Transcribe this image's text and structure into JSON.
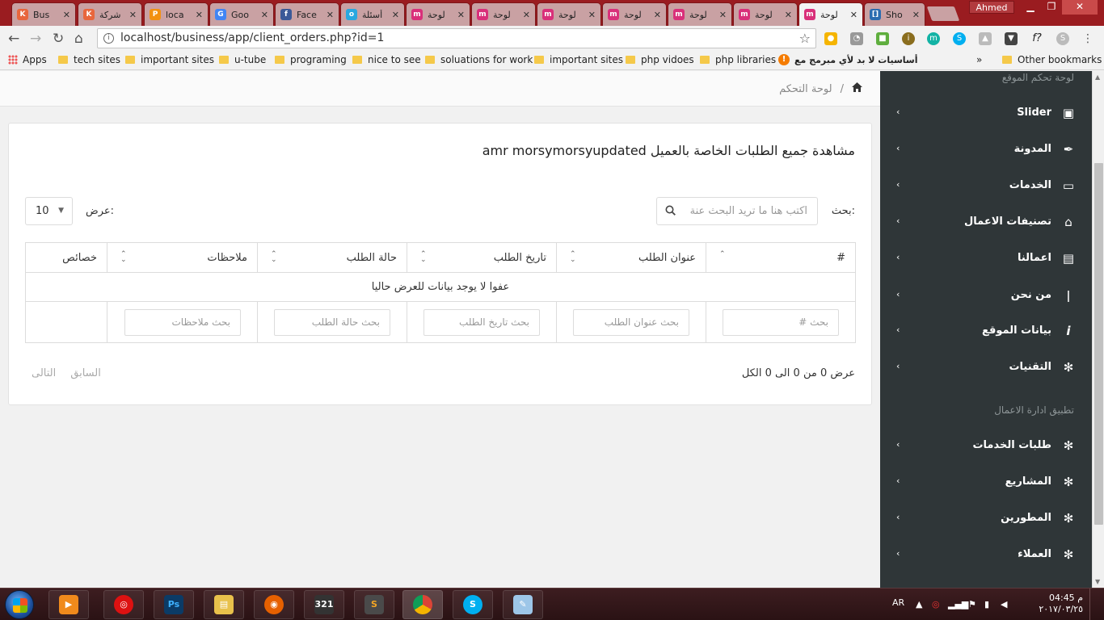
{
  "browser": {
    "tabs": [
      {
        "title": "Bus",
        "icon": "k-logo-icon",
        "color": "#e8663d"
      },
      {
        "title": "شركة",
        "icon": "k-logo-icon",
        "color": "#e8663d"
      },
      {
        "title": "loca",
        "icon": "phpmyadmin-icon",
        "color": "#f29111"
      },
      {
        "title": "Goo",
        "icon": "google-translate-icon",
        "color": "#4285f4"
      },
      {
        "title": "Face",
        "icon": "facebook-icon",
        "color": "#3b5998"
      },
      {
        "title": "أسئلة",
        "icon": "chat-bubble-icon",
        "color": "#29a8e0"
      },
      {
        "title": "لوحة",
        "icon": "m-logo-icon",
        "color": "#d9307a"
      },
      {
        "title": "لوحة",
        "icon": "m-logo-icon",
        "color": "#d9307a"
      },
      {
        "title": "لوحة",
        "icon": "m-logo-icon",
        "color": "#d9307a"
      },
      {
        "title": "لوحة",
        "icon": "m-logo-icon",
        "color": "#d9307a"
      },
      {
        "title": "لوحة",
        "icon": "m-logo-icon",
        "color": "#d9307a"
      },
      {
        "title": "لوحة",
        "icon": "m-logo-icon",
        "color": "#d9307a"
      },
      {
        "title": "لوحة",
        "icon": "m-logo-icon",
        "color": "#d9307a"
      },
      {
        "title": "Sho",
        "icon": "bracket-doc-icon",
        "color": "#2b6cb0"
      }
    ],
    "profile_name": "Ahmed",
    "url": "localhost/business/app/client_orders.php?id=1",
    "bookmarks": [
      {
        "label": "Apps",
        "icon": "apps-grid-icon"
      },
      {
        "label": "tech sites",
        "icon": "folder-icon"
      },
      {
        "label": "important sites",
        "icon": "folder-icon"
      },
      {
        "label": "u-tube",
        "icon": "folder-icon"
      },
      {
        "label": "programing",
        "icon": "folder-icon"
      },
      {
        "label": "nice to see",
        "icon": "folder-icon"
      },
      {
        "label": "soluations for work",
        "icon": "folder-icon"
      },
      {
        "label": "important sites",
        "icon": "folder-icon"
      },
      {
        "label": "php vidoes",
        "icon": "folder-icon"
      },
      {
        "label": "php libraries",
        "icon": "folder-icon"
      },
      {
        "label": "أساسيات لا بد لأي مبرمج مع",
        "icon": "info-orange-icon"
      }
    ],
    "more_bookmarks": "»",
    "other_bookmarks": "Other bookmarks"
  },
  "page": {
    "breadcrumb": {
      "home_icon": "home-icon",
      "separator": "/",
      "current": "لوحة التحكم"
    },
    "card": {
      "title": "مشاهدة جميع الطلبات الخاصة بالعميل amr morsymorsyupdated",
      "search_label": "بحث:",
      "search_placeholder": "اكتب هنا ما تريد البحث عنة",
      "length_label": "عرض:",
      "length_value": "10",
      "columns": [
        "#",
        "عنوان الطلب",
        "تاريخ الطلب",
        "حالة الطلب",
        "ملاحظات",
        "خصائص"
      ],
      "empty_message": "عفوا لا يوجد بيانات للعرض حاليا",
      "filters": [
        "بحث  #",
        "بحث  عنوان الطلب",
        "بحث  تاريخ الطلب",
        "بحث  حالة الطلب",
        "بحث  ملاحظات"
      ],
      "info": "عرض 0 من 0 الى 0 الكل",
      "prev": "السابق",
      "next": "التالى"
    }
  },
  "sidebar": {
    "section1": "لوحة تحكم الموقع",
    "section2": "تطبيق ادارة الاعمال",
    "items1": [
      {
        "label": "Slider",
        "icon": "image-icon"
      },
      {
        "label": "المدونة",
        "icon": "feather-icon"
      },
      {
        "label": "الخدمات",
        "icon": "laptop-icon"
      },
      {
        "label": "تصنيفات الاعمال",
        "icon": "tag-icon"
      },
      {
        "label": "اعمالنا",
        "icon": "briefcase-icon"
      },
      {
        "label": "من نحن",
        "icon": "person-icon"
      },
      {
        "label": "بيانات الموقع",
        "icon": "info-icon"
      },
      {
        "label": "التقنيات",
        "icon": "yelp-icon"
      }
    ],
    "items2": [
      {
        "label": "طلبات الخدمات",
        "icon": "yelp-icon"
      },
      {
        "label": "المشاريع",
        "icon": "yelp-icon"
      },
      {
        "label": "المطورين",
        "icon": "yelp-icon"
      },
      {
        "label": "العملاء",
        "icon": "yelp-icon"
      }
    ]
  },
  "taskbar": {
    "lang": "AR",
    "time": "04:45 م",
    "date": "٢٠١٧/٠٣/٢٥"
  }
}
